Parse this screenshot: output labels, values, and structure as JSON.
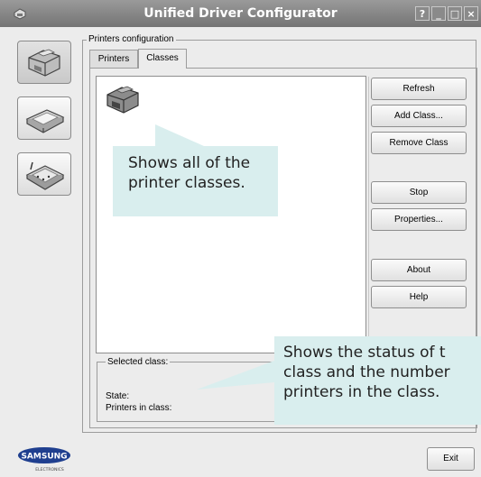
{
  "window": {
    "title": "Unified Driver Configurator",
    "controls": [
      "?",
      "_",
      "□",
      "×"
    ]
  },
  "sidebar": {
    "items": [
      {
        "name": "printers",
        "icon": "printer-icon",
        "active": true
      },
      {
        "name": "scanners",
        "icon": "scanner-icon",
        "active": false
      },
      {
        "name": "ports",
        "icon": "port-icon",
        "active": false
      }
    ]
  },
  "main": {
    "group_title": "Printers configuration",
    "tabs": [
      {
        "label": "Printers",
        "active": false
      },
      {
        "label": "Classes",
        "active": true
      }
    ],
    "buttons": {
      "refresh": "Refresh",
      "add_class": "Add Class...",
      "remove_class": "Remove Class",
      "stop": "Stop",
      "properties": "Properties...",
      "about": "About",
      "help": "Help"
    },
    "selected_class": {
      "title": "Selected class:",
      "state_label": "State:",
      "printers_label": "Printers in class:"
    }
  },
  "callouts": {
    "list_lines": [
      "Shows all of the",
      "printer classes."
    ],
    "status_lines": [
      "Shows the status of t",
      "class and the number",
      "printers in the class."
    ]
  },
  "footer": {
    "brand": "SAMSUNG",
    "brand_sub": "ELECTRONICS",
    "exit_label": "Exit"
  },
  "colors": {
    "titlebar": "#8a8a8a",
    "window_bg": "#ececec",
    "callout_bg": "#d9eeee",
    "brand_blue": "#1f3f8f"
  }
}
